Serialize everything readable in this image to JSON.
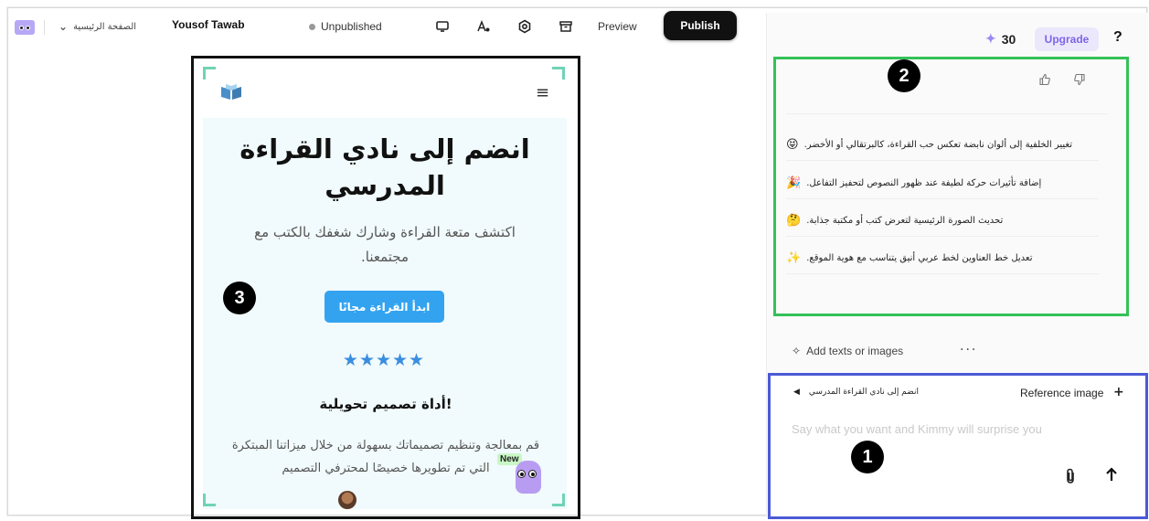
{
  "header": {
    "page_name": "الصفحة الرئيسية",
    "user_name": "Yousof Tawab",
    "status": "Unpublished",
    "preview_label": "Preview",
    "publish_label": "Publish",
    "credits": "30",
    "upgrade_label": "Upgrade",
    "help_label": "?"
  },
  "preview": {
    "hero_title": "انضم إلى نادي القراءة المدرسي",
    "hero_subtitle": "اكتشف متعة القراءة وشارك شغفك بالكتب مع مجتمعنا.",
    "cta_label": "ابدأ القراءة مجانًا",
    "stars": "★★★★★",
    "feature_title": "!أداة تصميم تحويلية",
    "feature_desc": "قم بمعالجة وتنظيم تصميماتك بسهولة من خلال ميزاتنا المبتكرة التي تم تطويرها خصيصًا لمحترفي التصميم",
    "new_badge": "New"
  },
  "suggestions": {
    "items": [
      {
        "text": ".تغيير الخلفية إلى ألوان نابضة تعكس حب القراءة، كالبرتقالي أو الأخضر",
        "emoji": "😝"
      },
      {
        "text": ".إضافة تأثيرات حركة لطيفة عند ظهور النصوص لتحفيز التفاعل",
        "emoji": "🎉"
      },
      {
        "text": ".تحديث الصورة الرئيسية لتعرض كتب أو مكتبة جذابة",
        "emoji": "🤔"
      },
      {
        "text": ".تعديل خط العناوين لخط عربي أنيق يتناسب مع هوية الموقع",
        "emoji": "✨"
      }
    ]
  },
  "composer": {
    "add_texts_label": "Add texts or images",
    "more_label": "···",
    "reference_crumb": "انضم إلى نادي القراءة المدرسي",
    "reference_image_label": "Reference image",
    "add_label": "+",
    "placeholder": "Say what you want and Kimmy will surprise you"
  },
  "markers": {
    "one": "1",
    "two": "2",
    "three": "3"
  },
  "colors": {
    "accent": "#7d65e8",
    "cta_blue": "#33a3f0",
    "green_outline": "#34c158",
    "blue_outline": "#4b5ad6"
  },
  "icons": [
    "app-logo-icon",
    "chevron-down-icon",
    "desktop-icon",
    "text-style-icon",
    "settings-icon",
    "archive-icon",
    "sparkle-icon",
    "thumbs-up-icon",
    "thumbs-down-icon",
    "book-icon",
    "menu-icon",
    "attach-icon",
    "send-icon",
    "caret-left-icon",
    "plus-icon"
  ]
}
